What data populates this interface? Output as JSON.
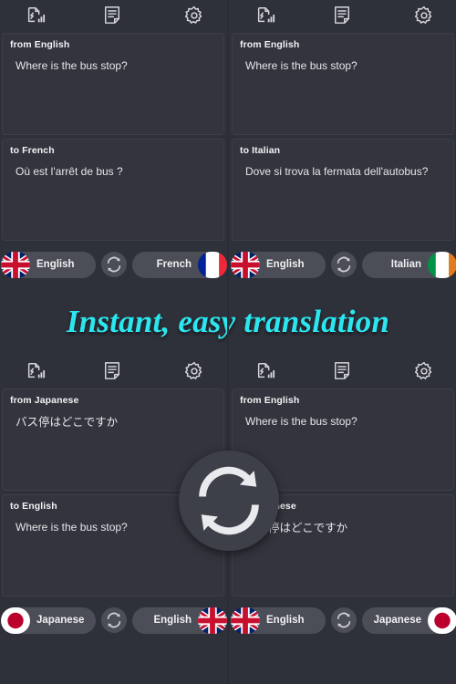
{
  "app": {
    "tagline": "Instant, easy translation",
    "accent_color": "#2ce6ef",
    "panel_color": "#33343d",
    "background_color": "#2e303a",
    "pill_color": "#4b4d57"
  },
  "toolbar": {
    "icons": [
      {
        "name": "speech-recognition-icon",
        "label": "Speech input"
      },
      {
        "name": "notes-icon",
        "label": "Notes"
      },
      {
        "name": "gear-icon",
        "label": "Settings"
      }
    ]
  },
  "screens": [
    {
      "id": "top-left",
      "from": {
        "label": "from English",
        "text": "Where is the bus stop?"
      },
      "to": {
        "label": "to French",
        "text": "Où est l'arrêt de bus ?"
      },
      "selector": {
        "source": {
          "language": "English",
          "flag": "uk"
        },
        "target": {
          "language": "French",
          "flag": "fr"
        },
        "swap_icon": "swap-icon"
      }
    },
    {
      "id": "top-right",
      "from": {
        "label": "from English",
        "text": "Where is the bus stop?"
      },
      "to": {
        "label": "to Italian",
        "text": "Dove si trova la fermata dell'autobus?"
      },
      "selector": {
        "source": {
          "language": "English",
          "flag": "uk"
        },
        "target": {
          "language": "Italian",
          "flag": "it"
        },
        "swap_icon": "swap-icon"
      }
    },
    {
      "id": "bottom-left",
      "from": {
        "label": "from Japanese",
        "text": "バス停はどこですか"
      },
      "to": {
        "label": "to English",
        "text": "Where is the bus stop?"
      },
      "selector": {
        "source": {
          "language": "Japanese",
          "flag": "jp"
        },
        "target": {
          "language": "English",
          "flag": "uk"
        },
        "swap_icon": "swap-icon"
      }
    },
    {
      "id": "bottom-right",
      "from": {
        "label": "from English",
        "text": "Where is the bus stop?"
      },
      "to": {
        "label": "to Japanese",
        "text": "バス停はどこですか"
      },
      "selector": {
        "source": {
          "language": "English",
          "flag": "uk"
        },
        "target": {
          "language": "Japanese",
          "flag": "jp"
        },
        "swap_icon": "swap-icon"
      }
    }
  ],
  "overlay": {
    "swap_button": {
      "name": "swap-languages-button",
      "icon": "swap-icon"
    }
  }
}
